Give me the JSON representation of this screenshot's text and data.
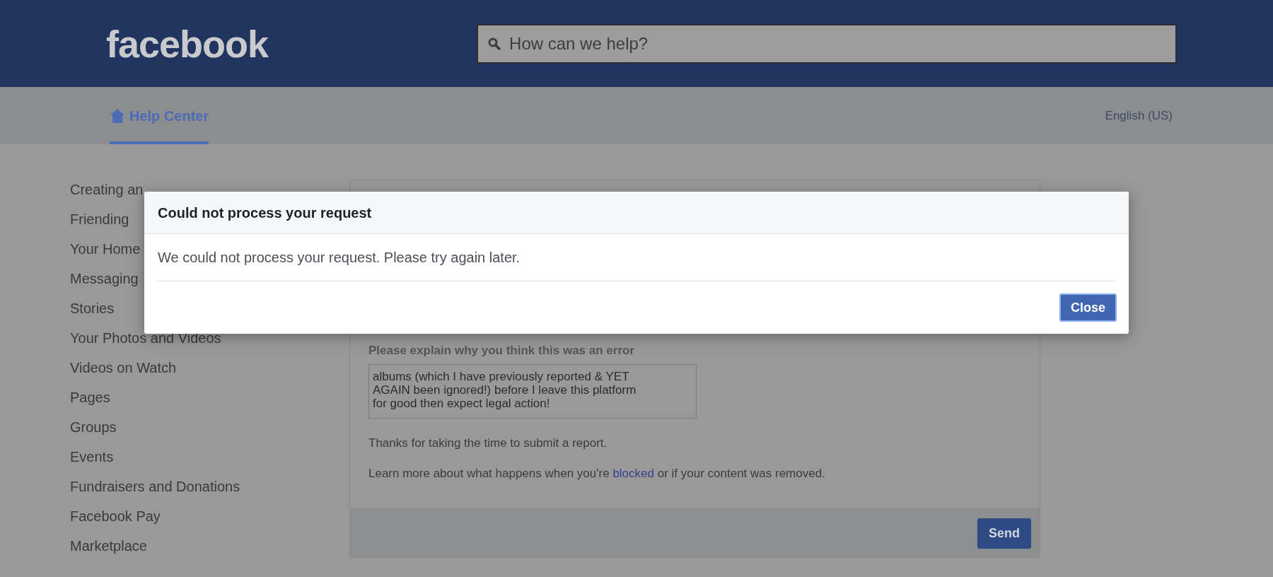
{
  "header": {
    "logo": "facebook",
    "search": {
      "placeholder": "How can we help?"
    }
  },
  "subnav": {
    "tabs": [
      {
        "label": "Help Center",
        "selected": true
      }
    ],
    "language": "English (US)"
  },
  "sidebar": {
    "items": [
      "Creating an",
      "Friending",
      "Your Home",
      "Messaging",
      "Stories",
      "Your Photos and Videos",
      "Videos on Watch",
      "Pages",
      "Groups",
      "Events",
      "Fundraisers and Donations",
      "Facebook Pay",
      "Marketplace"
    ]
  },
  "form": {
    "label": "Please explain why you think this was an error",
    "value": "albums (which I have previously reported & YET\nAGAIN been ignored!) before I leave this platform\nfor good then expect legal action!",
    "thanks": "Thanks for taking the time to submit a report.",
    "learn_more": {
      "before": "Learn more about what happens when you're",
      "link": "blocked",
      "after": "or if your content was removed."
    },
    "submit": "Send"
  },
  "dialog": {
    "title": "Could not process your request",
    "message": "We could not process your request. Please try again later.",
    "button": "Close"
  }
}
